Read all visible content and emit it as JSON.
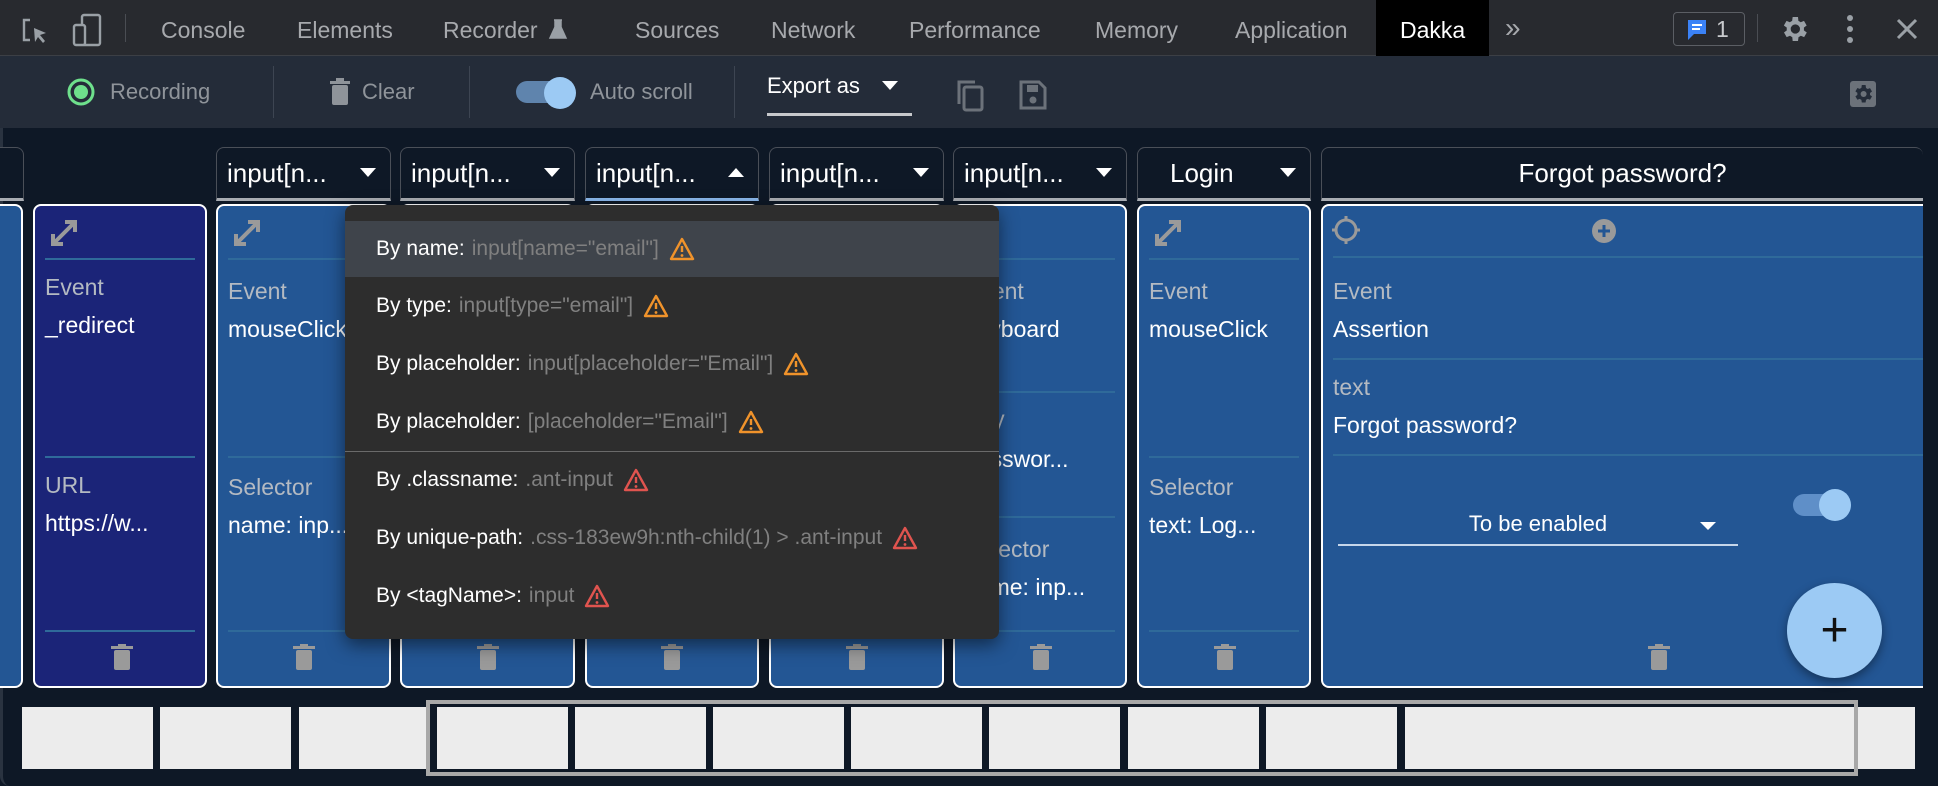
{
  "tabbar": {
    "tabs": [
      {
        "label": "Console"
      },
      {
        "label": "Elements"
      },
      {
        "label": "Recorder"
      },
      {
        "label": "Sources"
      },
      {
        "label": "Network"
      },
      {
        "label": "Performance"
      },
      {
        "label": "Memory"
      },
      {
        "label": "Application"
      },
      {
        "label": "Dakka",
        "active": true
      }
    ],
    "more_label": "»",
    "issues_count": "1",
    "icons": [
      "inspect-element-icon",
      "device-toolbar-icon",
      "flask-icon",
      "chevrons-right-icon",
      "message-icon",
      "gear-icon",
      "kebab-menu-icon",
      "close-icon"
    ]
  },
  "toolbar": {
    "recording_label": "Recording",
    "clear_label": "Clear",
    "autoscroll_label": "Auto scroll",
    "autoscroll_on": true,
    "export_label": "Export as",
    "accent": "#6ee08c"
  },
  "headers": [
    {
      "label": "input[n..."
    },
    {
      "label": "input[n..."
    },
    {
      "label": "input[n...",
      "open": true
    },
    {
      "label": "input[n..."
    },
    {
      "label": "input[n..."
    },
    {
      "label": "Login"
    },
    {
      "label": "Forgot password?"
    }
  ],
  "cards": [
    {
      "event_label": "Event",
      "event": "_redirect",
      "field_label": "URL",
      "field_value": "https://w..."
    },
    {
      "event_label": "Event",
      "event": "mouseClick",
      "field_label": "Selector",
      "field_value": "name: inp..."
    },
    {
      "event_label": "Event",
      "event": "keyboard",
      "key_label": "Key",
      "key_value": "passwor...",
      "field_label": "Selector",
      "field_value": "name: inp..."
    },
    {
      "event_label": "Event",
      "event": "mouseClick",
      "field_label": "Selector",
      "field_value": "text: Log..."
    },
    {
      "event_label": "Event",
      "event": "Assertion",
      "text_label": "text",
      "text_value": "Forgot password?",
      "condition": "To be enabled",
      "condition_on": true
    }
  ],
  "menu": {
    "items": [
      {
        "prefix": "By name:",
        "selector": "input[name=\"email\"]",
        "level": "warning"
      },
      {
        "prefix": "By type:",
        "selector": "input[type=\"email\"]",
        "level": "warning"
      },
      {
        "prefix": "By placeholder:",
        "selector": "input[placeholder=\"Email\"]",
        "level": "warning"
      },
      {
        "prefix": "By placeholder:",
        "selector": "[placeholder=\"Email\"]",
        "level": "warning"
      },
      {
        "prefix": "By .classname:",
        "selector": ".ant-input",
        "level": "danger"
      },
      {
        "prefix": "By unique-path:",
        "selector": ".css-183ew9h:nth-child(1) > .ant-input",
        "level": "danger"
      },
      {
        "prefix": "By <tagName>:",
        "selector": "input",
        "level": "danger"
      }
    ],
    "colors": {
      "warning": "#f0932b",
      "danger": "#e0544f"
    }
  },
  "fab_label": "+"
}
